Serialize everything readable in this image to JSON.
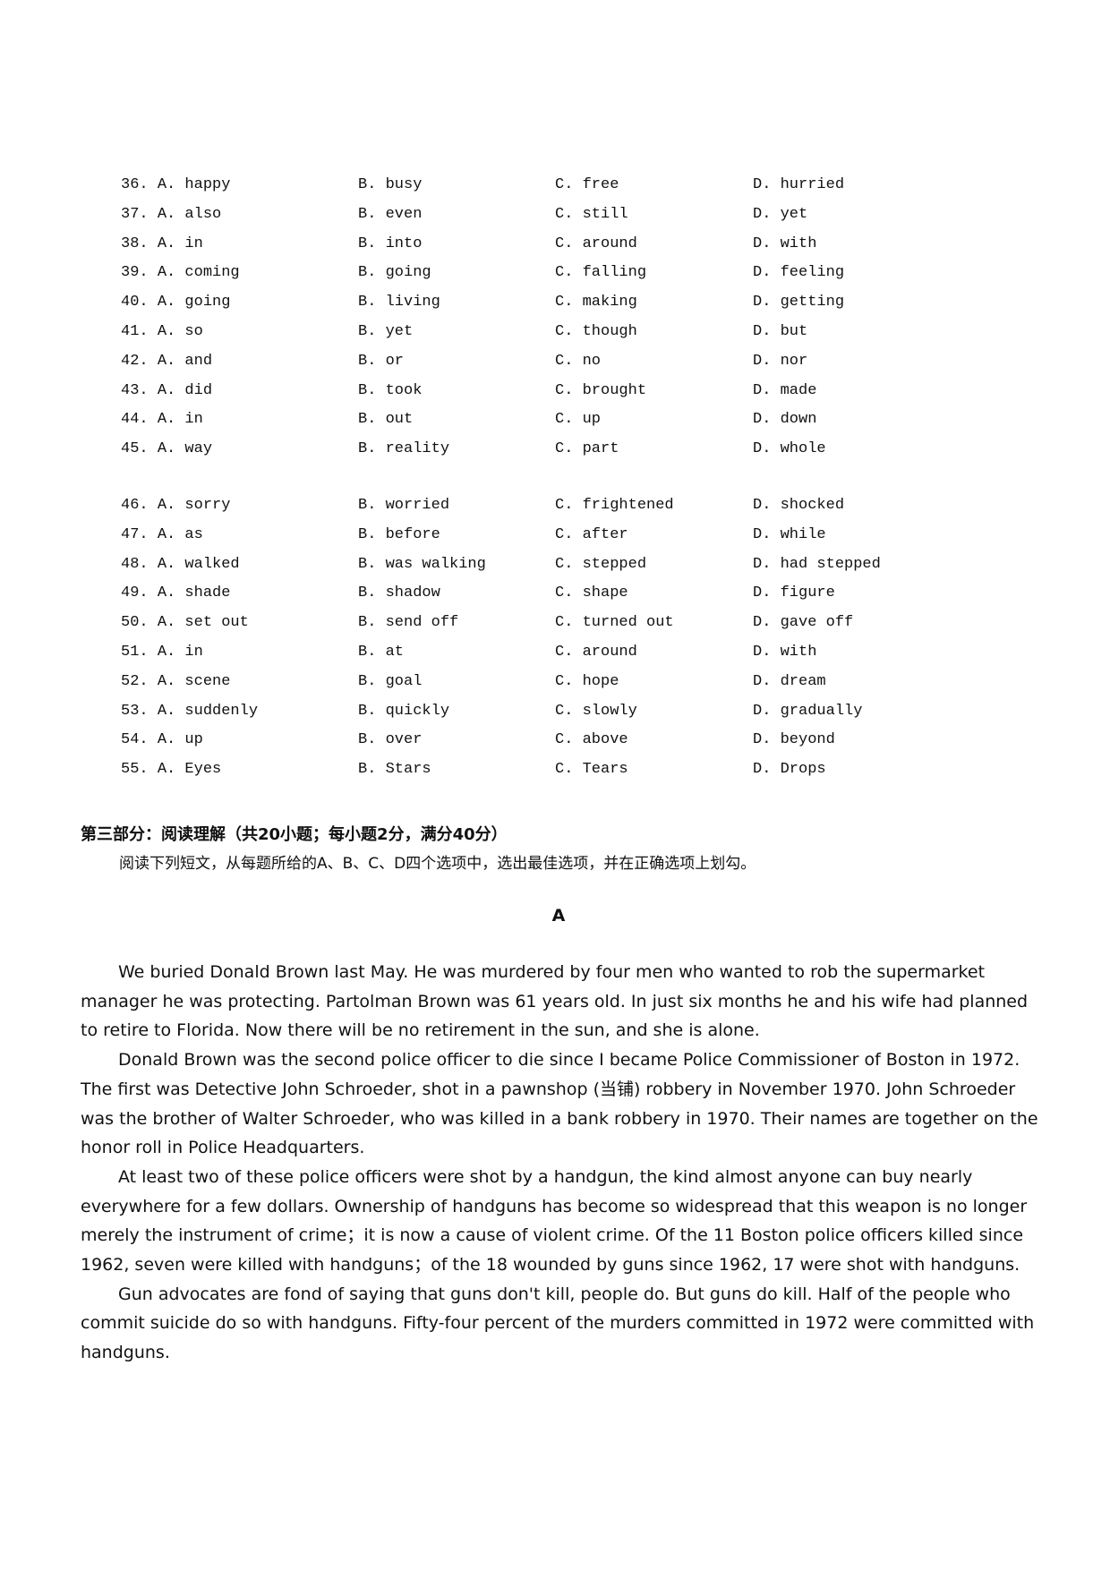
{
  "questions": [
    {
      "num": "36.",
      "a": "A. happy",
      "b": "B. busy",
      "c": "C. free",
      "d": "D. hurried"
    },
    {
      "num": "37.",
      "a": "A. also",
      "b": "B. even",
      "c": "C. still",
      "d": "D. yet"
    },
    {
      "num": "38.",
      "a": "A. in",
      "b": "B. into",
      "c": "C. around",
      "d": "D. with"
    },
    {
      "num": "39.",
      "a": "A. coming",
      "b": "B. going",
      "c": "C. falling",
      "d": "D. feeling"
    },
    {
      "num": "40.",
      "a": "A. going",
      "b": "B. living",
      "c": "C. making",
      "d": "D. getting"
    },
    {
      "num": "41.",
      "a": "A. so",
      "b": "B. yet",
      "c": "C. though",
      "d": "D. but"
    },
    {
      "num": "42.",
      "a": "A. and",
      "b": "B. or",
      "c": "C. no",
      "d": "D. nor"
    },
    {
      "num": "43.",
      "a": "A. did",
      "b": "B. took",
      "c": "C. brought",
      "d": "D. made"
    },
    {
      "num": "44.",
      "a": "A. in",
      "b": "B. out",
      "c": "C. up",
      "d": "D. down"
    },
    {
      "num": "45.",
      "a": "A. way",
      "b": "B. reality",
      "c": "C. part",
      "d": "D. whole"
    },
    {
      "num": "46.",
      "a": "A. sorry",
      "b": "B. worried",
      "c": "C. frightened",
      "d": "D. shocked"
    },
    {
      "num": "47.",
      "a": "A. as",
      "b": "B. before",
      "c": "C. after",
      "d": "D. while"
    },
    {
      "num": "48.",
      "a": "A. walked",
      "b": "B. was walking",
      "c": "C. stepped",
      "d": "D. had stepped"
    },
    {
      "num": "49.",
      "a": "A. shade",
      "b": "B. shadow",
      "c": "C. shape",
      "d": "D. figure"
    },
    {
      "num": "50.",
      "a": "A. set out",
      "b": "B. send off",
      "c": "C. turned out",
      "d": "D. gave off"
    },
    {
      "num": "51.",
      "a": "A. in",
      "b": "B. at",
      "c": "C. around",
      "d": "D. with"
    },
    {
      "num": "52.",
      "a": "A. scene",
      "b": "B. goal",
      "c": "C. hope",
      "d": "D. dream"
    },
    {
      "num": "53.",
      "a": "A. suddenly",
      "b": "B. quickly",
      "c": "C. slowly",
      "d": "D. gradually"
    },
    {
      "num": "54.",
      "a": "A. up",
      "b": "B. over",
      "c": "C. above",
      "d": "D. beyond"
    },
    {
      "num": "55.",
      "a": "A. Eyes",
      "b": "B. Stars",
      "c": "C. Tears",
      "d": "D. Drops"
    }
  ],
  "section": {
    "heading": "第三部分：阅读理解（共20小题；每小题2分，满分40分）",
    "instruction": "阅读下列短文，从每题所给的A、B、C、D四个选项中，选出最佳选项，并在正确选项上划勾。"
  },
  "passage": {
    "title": "A",
    "paragraphs": [
      "We buried Donald Brown last May. He was murdered by four men who wanted to rob the supermarket manager he was protecting. Partolman Brown was 61 years old. In just six months he and his wife had planned to retire to Florida. Now there will be no retirement in the sun, and she is alone.",
      "Donald Brown was the second police officer to die since I became Police Commissioner of Boston in 1972. The first was Detective John Schroeder, shot in a pawnshop (当铺) robbery in November 1970. John Schroeder was the brother of Walter Schroeder, who was killed in a bank robbery in 1970. Their names are together on the honor roll in Police Headquarters.",
      "At least two of these police officers were shot by a handgun, the kind almost anyone can buy nearly everywhere for a few dollars. Ownership of handguns has become so widespread that this weapon is no longer merely the instrument of crime；it is now a cause of violent crime. Of the 11 Boston police officers killed since 1962, seven were killed with handguns；of the 18 wounded by guns since 1962, 17 were shot with handguns.",
      "Gun advocates are fond of saying that guns don't kill, people do. But guns do kill. Half of the people who commit suicide do so with handguns. Fifty-four percent of the murders committed in 1972 were committed with handguns."
    ]
  }
}
